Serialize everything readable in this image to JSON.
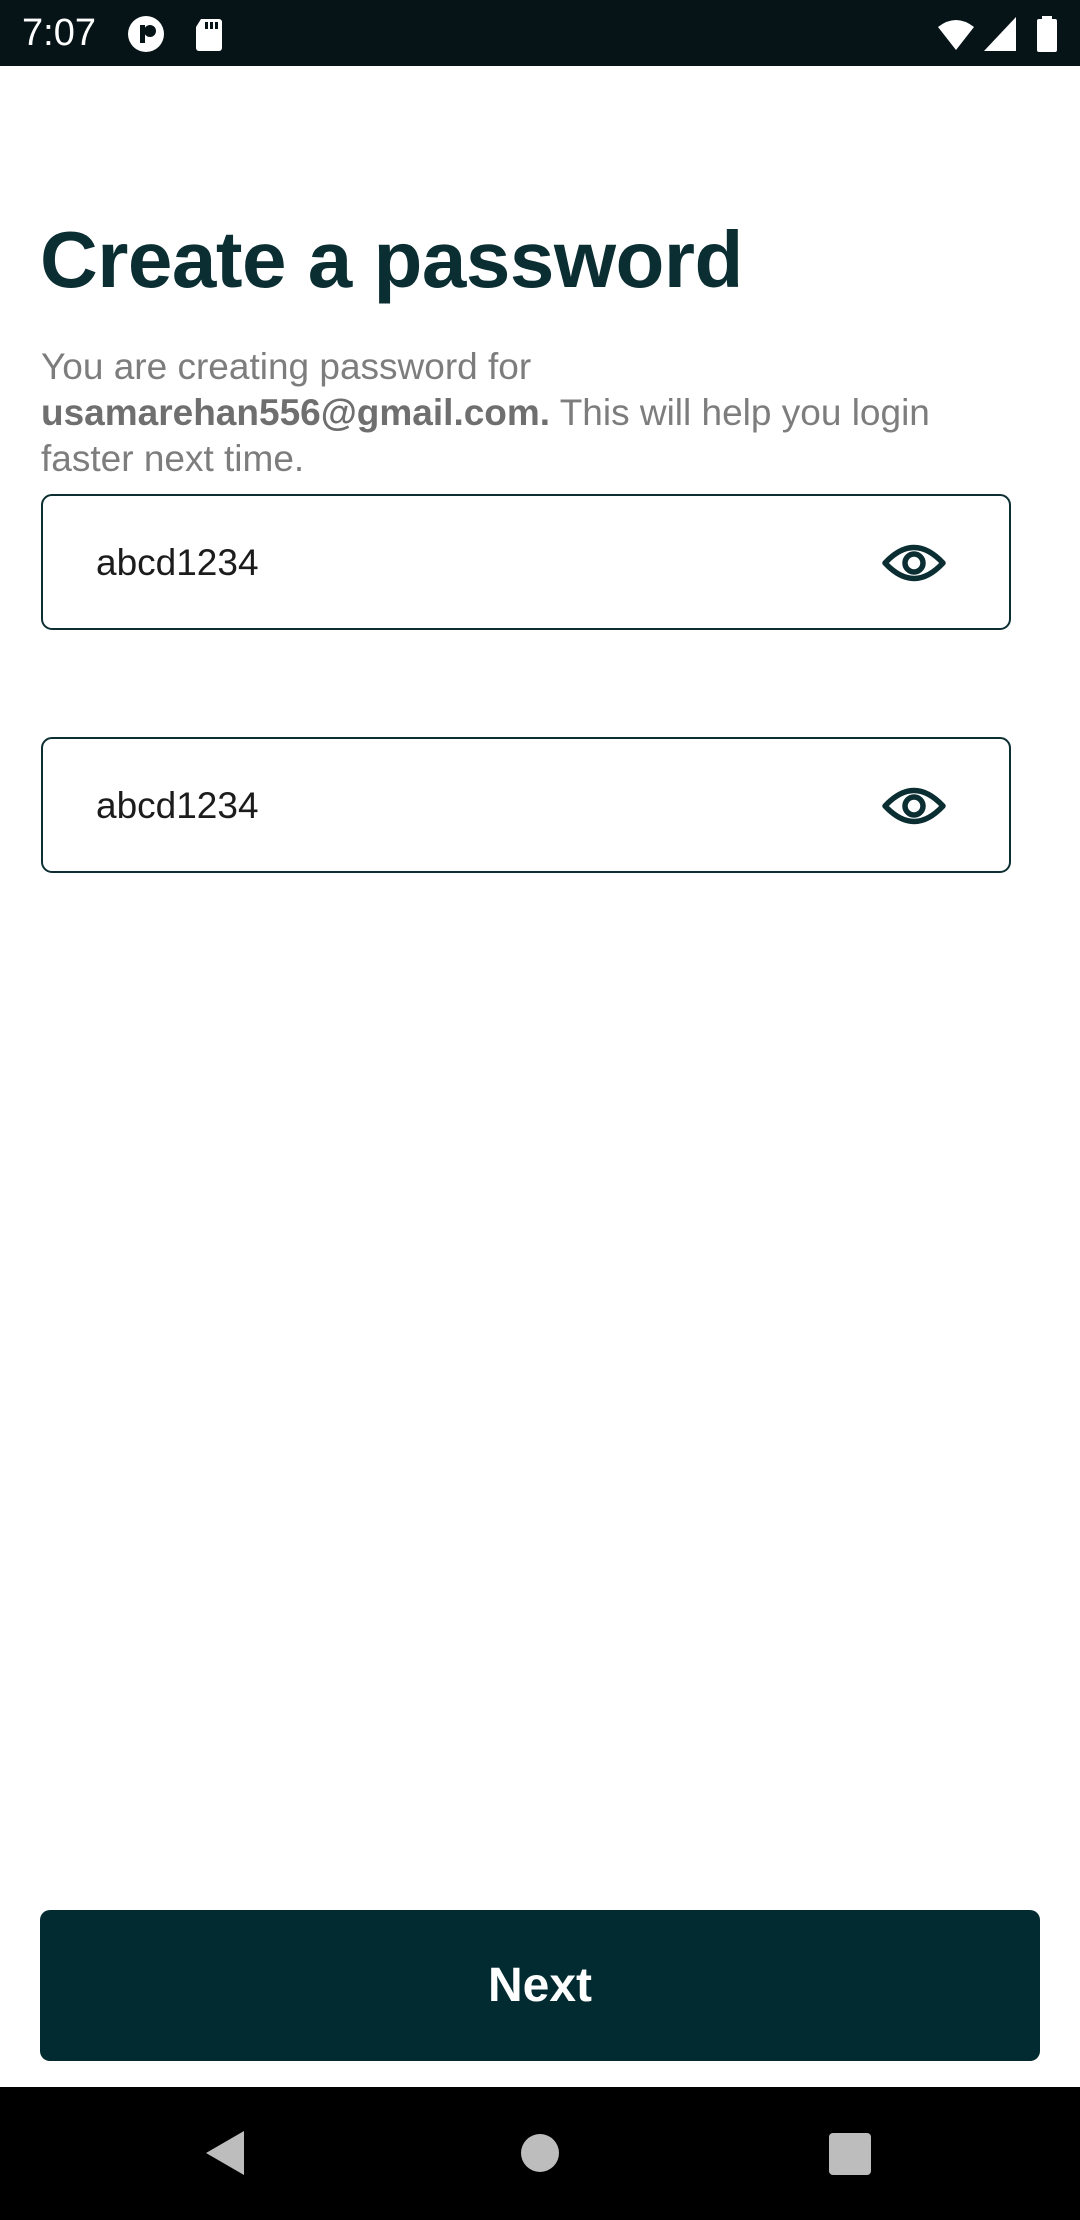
{
  "status_bar": {
    "time": "7:07",
    "icons": [
      "app-notification-icon",
      "sd-card-icon",
      "wifi-icon",
      "cell-signal-icon",
      "battery-icon"
    ]
  },
  "page": {
    "title": "Create a password",
    "subtitle_prefix": "You are creating password for ",
    "email": "usamarehan556@gmail.com.",
    "subtitle_suffix": " This will help you login faster next time."
  },
  "password_field": {
    "value": "abcd1234",
    "toggle_icon": "eye-icon"
  },
  "confirm_password_field": {
    "value": "abcd1234",
    "toggle_icon": "eye-icon"
  },
  "actions": {
    "next_label": "Next"
  },
  "nav_bar": {
    "icons": [
      "back-icon",
      "home-icon",
      "recents-icon"
    ]
  },
  "colors": {
    "primary": "#012b30",
    "title": "#0b2e33",
    "subtitle": "#7d7d7d",
    "status_bar": "#061418",
    "nav_bar": "#000000"
  }
}
